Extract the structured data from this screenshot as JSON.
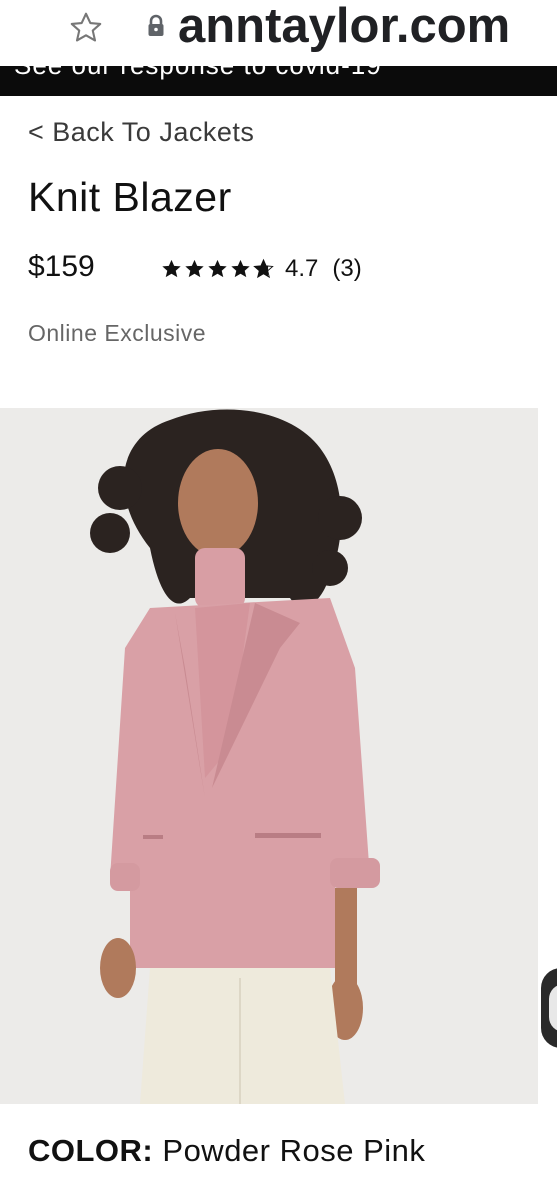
{
  "browser": {
    "domain": "anntaylor.com",
    "icons": [
      "star-icon",
      "lock-icon"
    ]
  },
  "banner": {
    "text": "See our response to covid-19"
  },
  "product": {
    "back_link": "< Back To Jackets",
    "title": "Knit Blazer",
    "price": "$159",
    "rating": {
      "stars": 4.7,
      "value": "4.7",
      "count": "(3)"
    },
    "badge": "Online Exclusive",
    "color_label": "COLOR:",
    "color_value": "Powder Rose Pink"
  },
  "colors": {
    "blazer": "#d9a0a6",
    "pants": "#eeeadc",
    "background": "#ecebe9",
    "banner": "#0b0b0b"
  }
}
